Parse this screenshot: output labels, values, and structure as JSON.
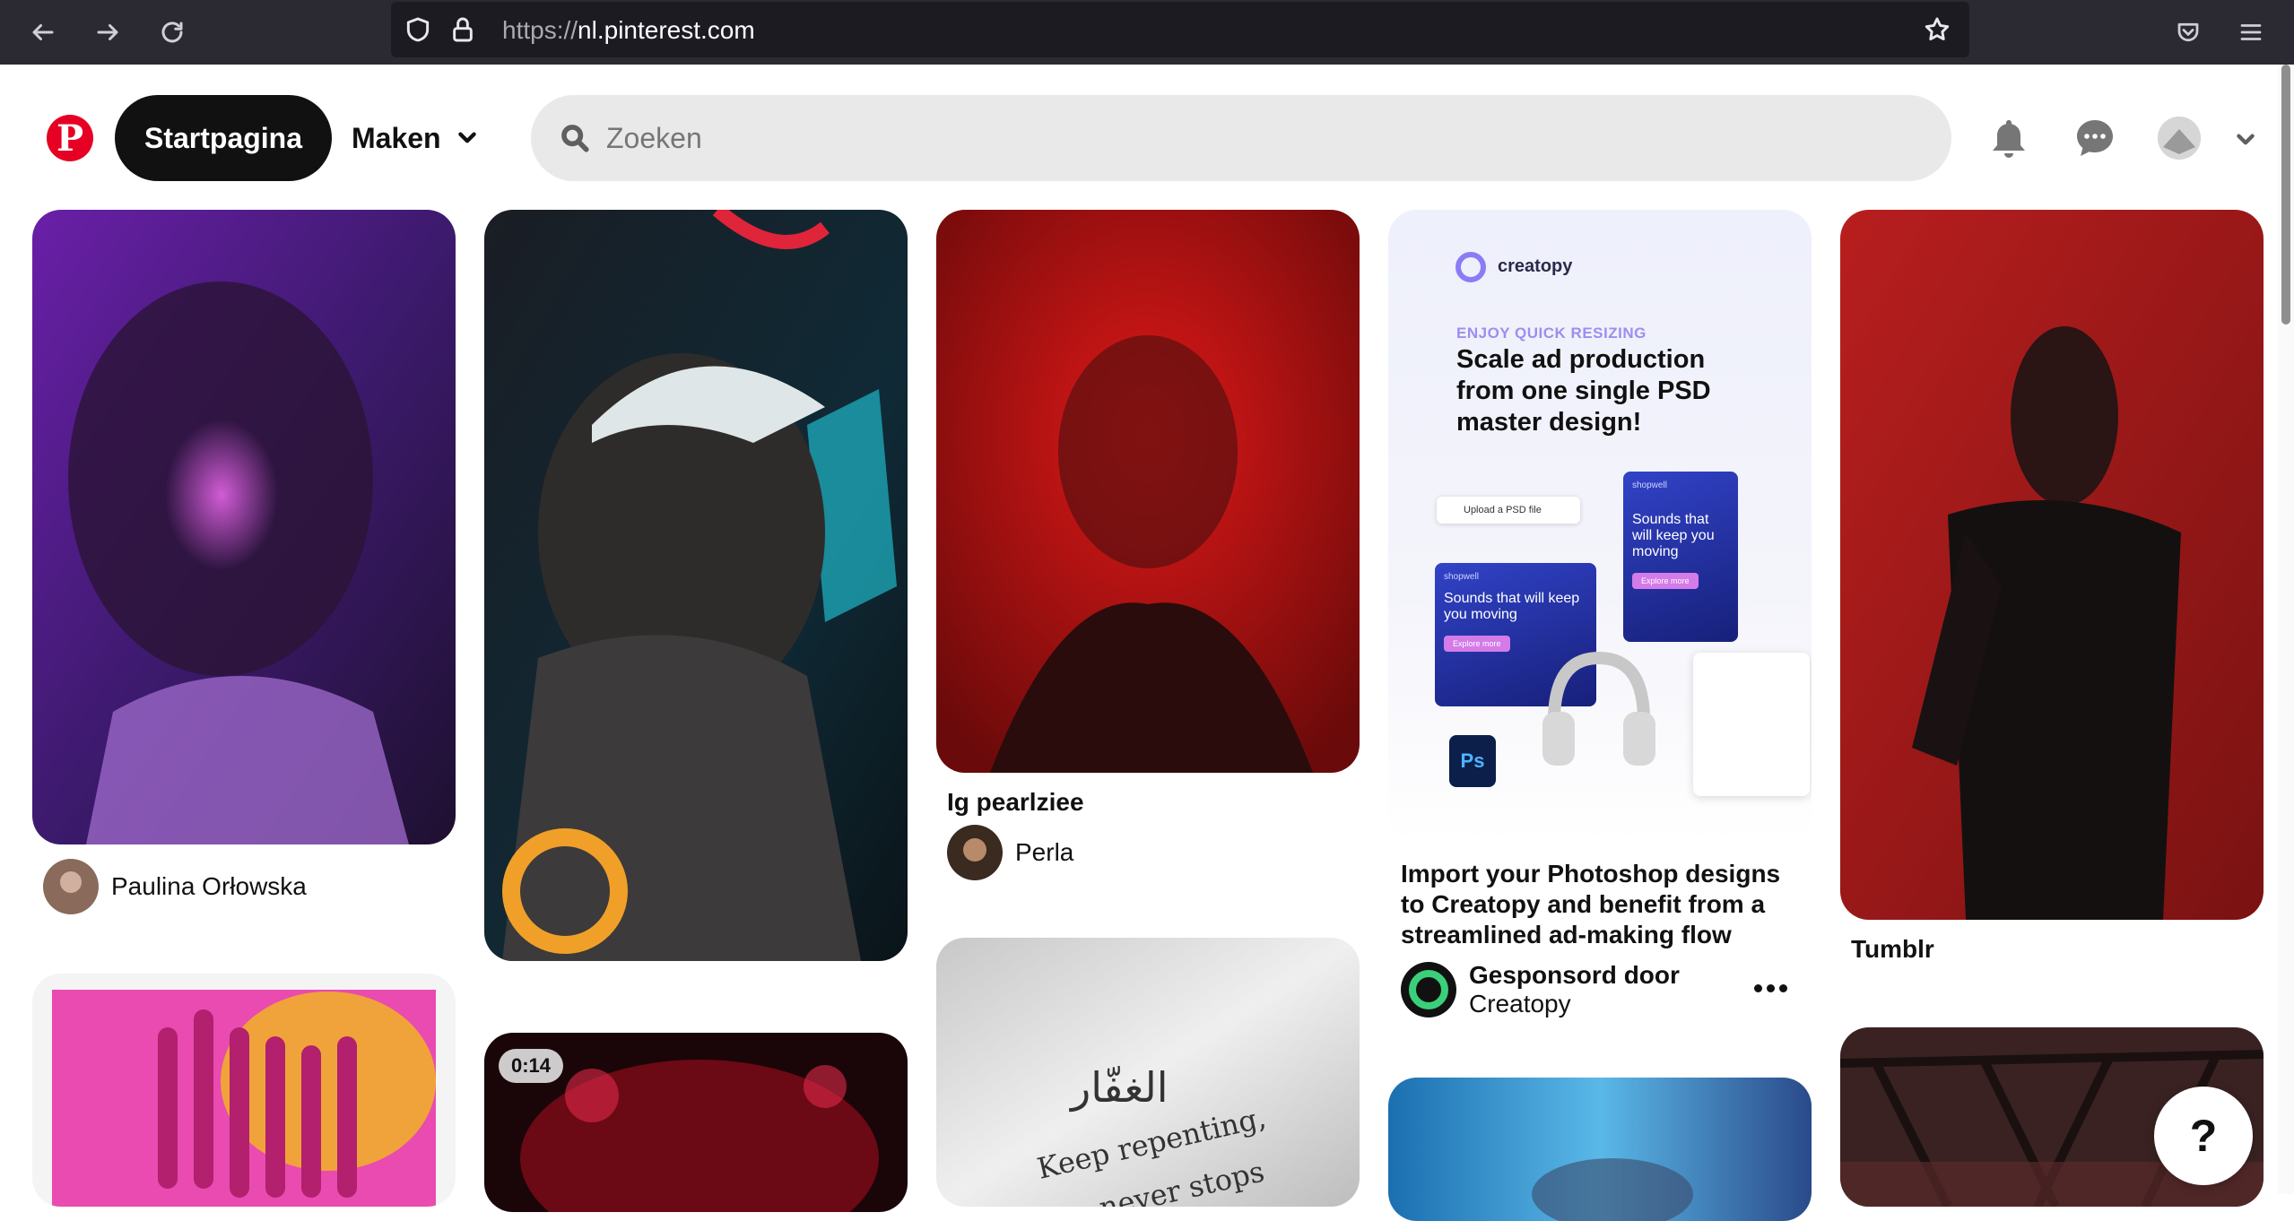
{
  "browser": {
    "url_protocol": "https://",
    "url_host": "nl.pinterest.com"
  },
  "header": {
    "home_label": "Startpagina",
    "create_label": "Maken",
    "search_placeholder": "Zoeken"
  },
  "pins": {
    "pin1_owner": "Paulina Orłowska",
    "pin3_title": "Ig pearlziee",
    "pin3_owner": "Perla",
    "ad": {
      "logo_text": "creatopy",
      "kicker": "ENJOY QUICK RESIZING",
      "headline": "Scale ad production from one single PSD master design!",
      "upload_label": "Upload a PSD file",
      "card_brand": "shopwell",
      "card1_text": "Sounds that will keep you moving",
      "card2_text": "Sounds that will keep you moving",
      "card_cta": "Explore more",
      "ps_label": "Ps",
      "title": "Import your Photoshop designs to Creatopy and benefit from a streamlined ad-making flow",
      "sponsored_label": "Gesponsord door",
      "sponsor_name": "Creatopy"
    },
    "pin5_title": "Tumblr",
    "video_duration": "0:14",
    "typography_arabic": "الغفّار",
    "typography_line1": "Keep repenting,",
    "typography_line2": "never stops"
  },
  "help_label": "?",
  "colors": {
    "brand_red": "#e60023",
    "dark": "#111111",
    "chrome_bg": "#2b2a33",
    "search_bg": "#e9e9e9"
  }
}
